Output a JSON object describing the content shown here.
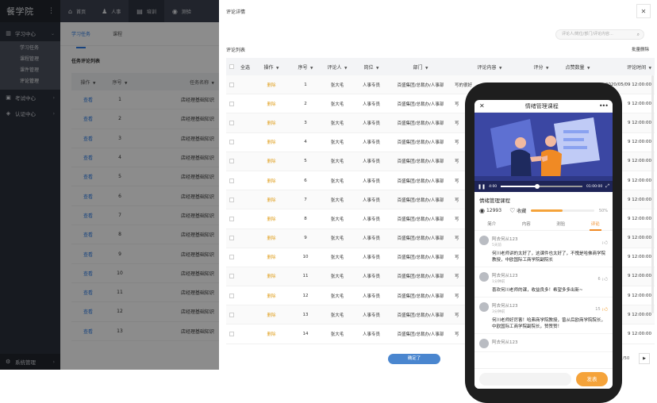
{
  "app": {
    "logo": "餐学院"
  },
  "topnav": [
    {
      "label": "首页",
      "icon": "home-icon"
    },
    {
      "label": "人事",
      "icon": "user-icon"
    },
    {
      "label": "培训",
      "icon": "book-icon"
    },
    {
      "label": "测验",
      "icon": "quiz-icon"
    }
  ],
  "sidebar": {
    "groups": [
      {
        "label": "学习中心",
        "icon": "study-icon",
        "items": [
          "学习任务",
          "课程管理",
          "课件管理",
          "评论管理"
        ]
      },
      {
        "label": "考试中心",
        "icon": "exam-icon"
      },
      {
        "label": "认证中心",
        "icon": "cert-icon"
      }
    ],
    "bottom": "系统管理"
  },
  "content": {
    "tabs": [
      "学习任务",
      "课程"
    ],
    "list_title": "任务评论列表",
    "columns": [
      "操作",
      "序号",
      "任务名称"
    ],
    "view_label": "查看",
    "task_name": "店经理基础知识",
    "rows": [
      "1",
      "2",
      "3",
      "4",
      "5",
      "6",
      "7",
      "8",
      "9",
      "10",
      "11",
      "12",
      "13"
    ]
  },
  "panel": {
    "title": "评论详情",
    "search_placeholder": "评论人/岗位/部门/评论内容...",
    "section_title": "评论列表",
    "batch_delete": "批量删除",
    "columns": [
      "全选",
      "操作",
      "序号",
      "评论人",
      "岗位",
      "部门",
      "评论内容",
      "评分",
      "点赞数量",
      "评论时间"
    ],
    "delete_label": "删除",
    "commenter": "张大毛",
    "position": "人事专员",
    "department": "百盛集团/总裁办/人事部",
    "content_first": "写的很好",
    "content_short": "写",
    "time_first": "2020/05/09 12:00:00",
    "time_rest": "9 12:00:00",
    "row_numbers": [
      "1",
      "2",
      "3",
      "4",
      "5",
      "6",
      "7",
      "8",
      "9",
      "10",
      "11",
      "12",
      "13",
      "14"
    ],
    "confirm": "确定了",
    "pager": "5/50"
  },
  "phone": {
    "title": "情绪管理课程",
    "course_name": "情绪管理课程",
    "time_current": "4:00",
    "time_total": "01:00:00",
    "video_progress": 0.45,
    "views": "12993",
    "favorite": "收藏",
    "progress": 0.5,
    "progress_text": "50%",
    "tabs": [
      "简介",
      "内容",
      "测验",
      "评论"
    ],
    "comments": [
      {
        "name": "阿去何从123",
        "time": "5天前",
        "text": "何川老师讲的太好了，这课件也太好了，不愧是哈佛商学院教授，中欧国际工商学院副院长",
        "likes": ""
      },
      {
        "name": "阿去何从123",
        "time": "1分钟前",
        "text": "喜欢何川老师的课，收益良多！希望多多出新~",
        "likes": "6"
      },
      {
        "name": "阿去何从123",
        "time": "3分钟前",
        "text": "何川老师好厉害！哈弗商学院教授，曾从后欧商学院院长，中欧国际工商学院副院长，赞赞赞！",
        "likes": "15"
      },
      {
        "name": "阿去何从123",
        "time": "",
        "text": "",
        "likes": ""
      }
    ],
    "send": "发表"
  },
  "colors": {
    "accent": "#2c7be5",
    "orange": "#f5a33a",
    "delete": "#e0a020",
    "sidebar": "#2b303b"
  }
}
